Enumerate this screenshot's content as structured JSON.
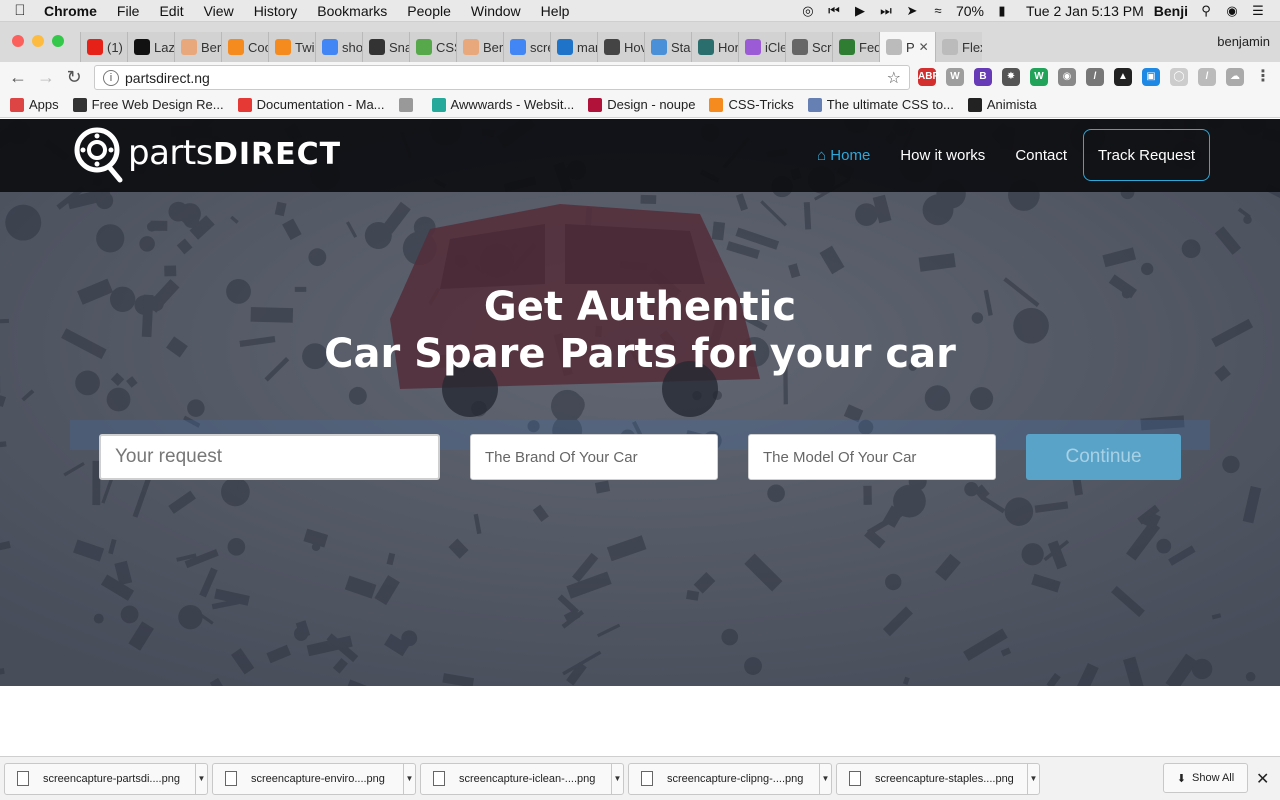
{
  "menubar": {
    "app": "Chrome",
    "items": [
      "File",
      "Edit",
      "View",
      "History",
      "Bookmarks",
      "People",
      "Window",
      "Help"
    ],
    "battery": "70%",
    "datetime": "Tue 2 Jan  5:13 PM",
    "user": "Benji"
  },
  "tabs": [
    {
      "label": "(1)",
      "icon": "youtube-icon",
      "color": "#e62117"
    },
    {
      "label": "Laz",
      "icon": "tl-icon",
      "color": "#111111"
    },
    {
      "label": "Ber",
      "icon": "person-icon",
      "color": "#e8a87c"
    },
    {
      "label": "Coc",
      "icon": "asterisk-icon",
      "color": "#f58a1f"
    },
    {
      "label": "Twi",
      "icon": "asterisk-icon",
      "color": "#f58a1f"
    },
    {
      "label": "sho",
      "icon": "google-icon",
      "color": "#4285f4"
    },
    {
      "label": "Sna",
      "icon": "snap-icon",
      "color": "#333333"
    },
    {
      "label": "CSS",
      "icon": "css-icon",
      "color": "#57a84a"
    },
    {
      "label": "Ber",
      "icon": "person-icon",
      "color": "#e8a87c"
    },
    {
      "label": "scre",
      "icon": "google-icon",
      "color": "#4285f4"
    },
    {
      "label": "mar",
      "icon": "bracket-icon",
      "color": "#1f73c9"
    },
    {
      "label": "Hov",
      "icon": "x-box-icon",
      "color": "#444444"
    },
    {
      "label": "Sta",
      "icon": "spinner-icon",
      "color": "#4a90d9"
    },
    {
      "label": "Hor",
      "icon": "eye-icon",
      "color": "#2a6e6e"
    },
    {
      "label": "iCle",
      "icon": "ic-icon",
      "color": "#9c5bd6"
    },
    {
      "label": "Scr",
      "icon": "camera-icon",
      "color": "#666666"
    },
    {
      "label": "Fed",
      "icon": "seal-icon",
      "color": "#2e7d32"
    },
    {
      "label": "P",
      "icon": "page-icon",
      "color": "#bbbbbb",
      "active": true
    },
    {
      "label": "Flex",
      "icon": "page-icon",
      "color": "#bbbbbb"
    }
  ],
  "profile_name": "benjamin",
  "address": "partsdirect.ng",
  "bookmarks": [
    {
      "label": "Apps",
      "icon": "apps-grid-icon",
      "color": "#d44"
    },
    {
      "label": "Free Web Design Re...",
      "icon": "pen-icon",
      "color": "#333"
    },
    {
      "label": "Documentation - Ma...",
      "icon": "m-icon",
      "color": "#e53935"
    },
    {
      "label": "",
      "icon": "page-icon",
      "color": "#999"
    },
    {
      "label": "Awwwards - Websit...",
      "icon": "square-icon",
      "color": "#25a99a"
    },
    {
      "label": "Design - noupe",
      "icon": "n-icon",
      "color": "#b0123a"
    },
    {
      "label": "CSS-Tricks",
      "icon": "asterisk-icon",
      "color": "#f58a1f"
    },
    {
      "label": "The ultimate CSS to...",
      "icon": "folder-icon",
      "color": "#6680b3"
    },
    {
      "label": "Animista",
      "icon": "a-circle-icon",
      "color": "#222"
    }
  ],
  "site": {
    "logo_parts": "parts",
    "logo_direct": "DIRECT",
    "nav": [
      {
        "label": "Home",
        "active": true
      },
      {
        "label": "How it works",
        "active": false
      },
      {
        "label": "Contact",
        "active": false
      }
    ],
    "track_button": "Track Request",
    "headline_line1": "Get Authentic",
    "headline_line2": "Car Spare Parts for your car",
    "form": {
      "request_placeholder": "Your request",
      "brand_placeholder": "The Brand Of Your Car",
      "model_placeholder": "The Model Of Your Car",
      "continue_label": "Continue"
    },
    "accent_color": "#2ea8d9"
  },
  "downloads": {
    "files": [
      "screencapture-partsdi....png",
      "screencapture-enviro....png",
      "screencapture-iclean-....png",
      "screencapture-clipng-....png",
      "screencapture-staples....png"
    ],
    "show_all": "Show All"
  }
}
